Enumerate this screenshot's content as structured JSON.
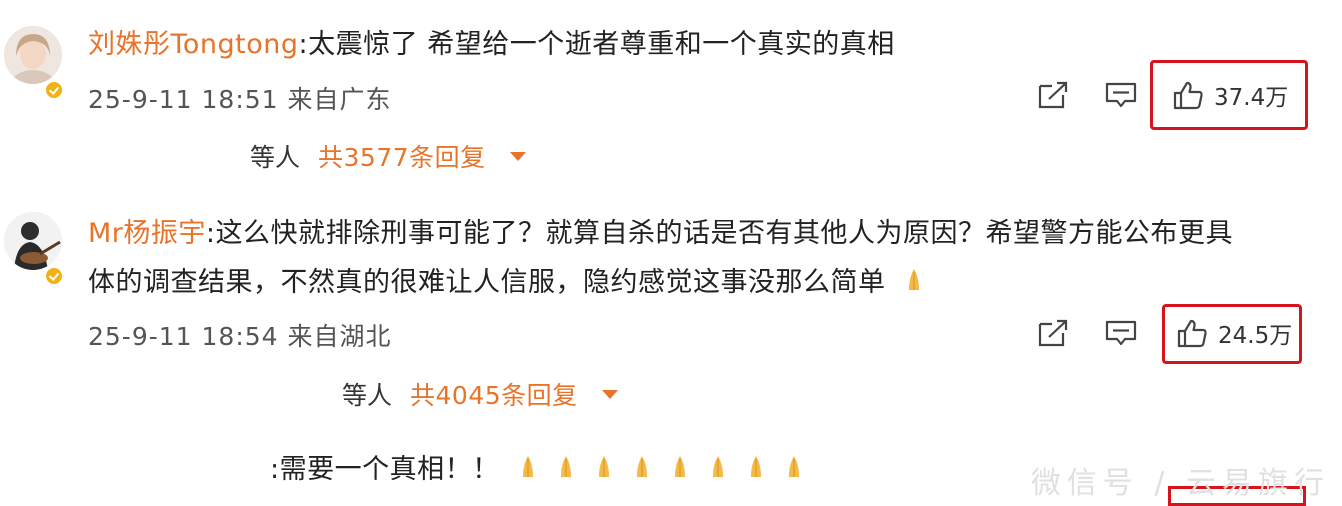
{
  "comments": [
    {
      "username": "刘姝彤Tongtong",
      "text": ":太震惊了 希望给一个逝者尊重和一个真实的真相",
      "timestamp": "25-9-11 18:51",
      "location": "来自广东",
      "likes": "37.4万",
      "reply_prefix": "等人",
      "reply_count": "共3577条回复"
    },
    {
      "username": "Mr杨振宇",
      "text_line1": ":这么快就排除刑事可能了？就算自杀的话是否有其他人为原因？希望警方能公布更具",
      "text_line2": "体的调查结果，不然真的很难让人信服，隐约感觉这事没那么简单",
      "timestamp": "25-9-11 18:54",
      "location": "来自湖北",
      "likes": "24.5万",
      "reply_prefix": "等人",
      "reply_count": "共4045条回复"
    }
  ],
  "partial_comment": {
    "text": ":需要一个真相！！"
  },
  "watermark": "微信号 / 云易旗行",
  "colors": {
    "username": "#e8742a",
    "highlight_box": "#d8141b",
    "badge": "#f2b216"
  },
  "icons": [
    "share-icon",
    "comment-icon",
    "thumbs-up-icon",
    "caret-down-icon",
    "praying-hands-emoji"
  ]
}
